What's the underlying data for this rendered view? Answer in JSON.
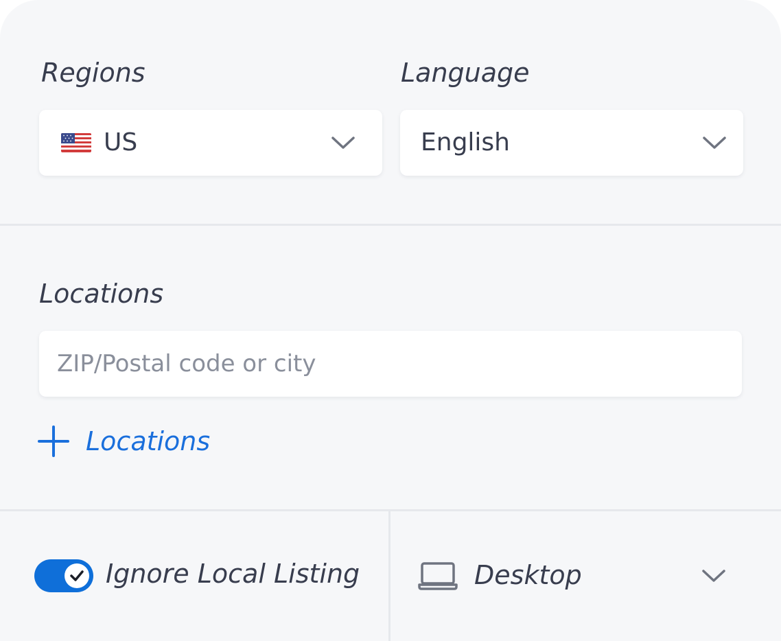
{
  "regions": {
    "label": "Regions",
    "value": "US",
    "flag_icon": "us-flag-icon"
  },
  "language": {
    "label": "Language",
    "value": "English"
  },
  "locations": {
    "label": "Locations",
    "input_placeholder": "ZIP/Postal code or city",
    "input_value": "",
    "add_label": "Locations",
    "add_icon": "plus-icon"
  },
  "ignore_local_listing": {
    "label": "Ignore Local Listing",
    "enabled": true,
    "toggle_icon": "checkmark-icon"
  },
  "device": {
    "value": "Desktop",
    "icon": "laptop-icon"
  },
  "colors": {
    "accent": "#1a6fdc",
    "toggle_on": "#0f6fd9",
    "background": "#f6f7f9",
    "text": "#383d4e",
    "muted": "#8a8f9b",
    "divider": "#e6e8ec"
  }
}
